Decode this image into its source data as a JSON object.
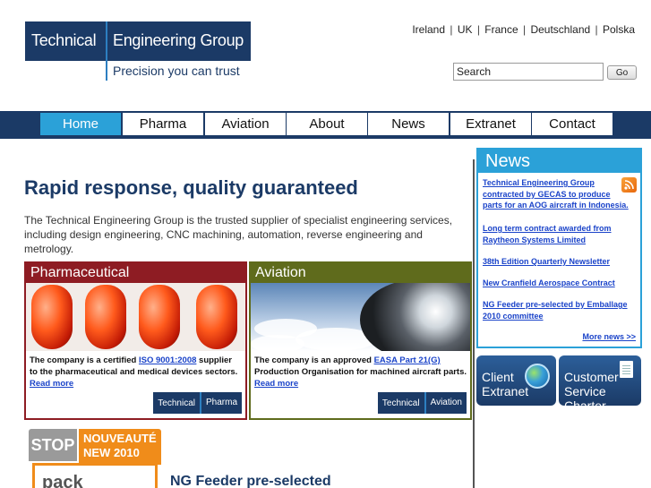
{
  "header": {
    "logo_left": "Technical",
    "logo_right": "Engineering Group",
    "tagline": "Precision you can trust",
    "languages": [
      "Ireland",
      "UK",
      "France",
      "Deutschland",
      "Polska"
    ],
    "search_value": "Search",
    "go_label": "Go"
  },
  "nav": [
    "Home",
    "Pharma",
    "Aviation",
    "About",
    "News",
    "Extranet",
    "Contact"
  ],
  "main": {
    "headline": "Rapid response, quality guaranteed",
    "intro": "The Technical Engineering Group is the trusted supplier of specialist engineering services, including design engineering, CNC machining, automation, reverse engineering and metrology.",
    "pharma": {
      "title": "Pharmaceutical",
      "text_before": "The company is a certified ",
      "link": "ISO 9001:2008",
      "text_after": " supplier to the pharmaceutical and medical devices sectors. ",
      "read_more": "Read more",
      "logo_left": "Technical",
      "logo_right": "Pharma"
    },
    "aviation": {
      "title": "Aviation",
      "text_before": "The company is an approved ",
      "link": "EASA Part 21(G)",
      "text_after": " Production Organisation for machined aircraft parts. ",
      "read_more": "Read more",
      "logo_left": "Technical",
      "logo_right": "Aviation"
    },
    "badge": {
      "stop": "STOP",
      "nouveaute": "NOUVEAUTÉ",
      "year": "NEW 2010",
      "pack": "pack"
    },
    "story_heading": "NG Feeder pre-selected"
  },
  "sidebar": {
    "news_title": "News",
    "news_items": [
      "Technical Engineering Group contracted by GECAS to produce parts for an AOG aircraft in Indonesia.",
      "Long term contract awarded from Raytheon Systems Limited",
      "38th Edition Quarterly Newsletter",
      "New Cranfield Aerospace Contract",
      "NG Feeder pre-selected by Emballage 2010 committee"
    ],
    "more_news": "More news >>",
    "client_line1": "Client",
    "client_line2": "Extranet",
    "charter_line1": "Customer",
    "charter_line2": "Service Charter"
  },
  "colors": {
    "navy": "#1b3a66",
    "accent_blue": "#2ba1d8",
    "pharma": "#8e1c23",
    "aviation": "#5f6b1c",
    "orange": "#f08c1a"
  }
}
